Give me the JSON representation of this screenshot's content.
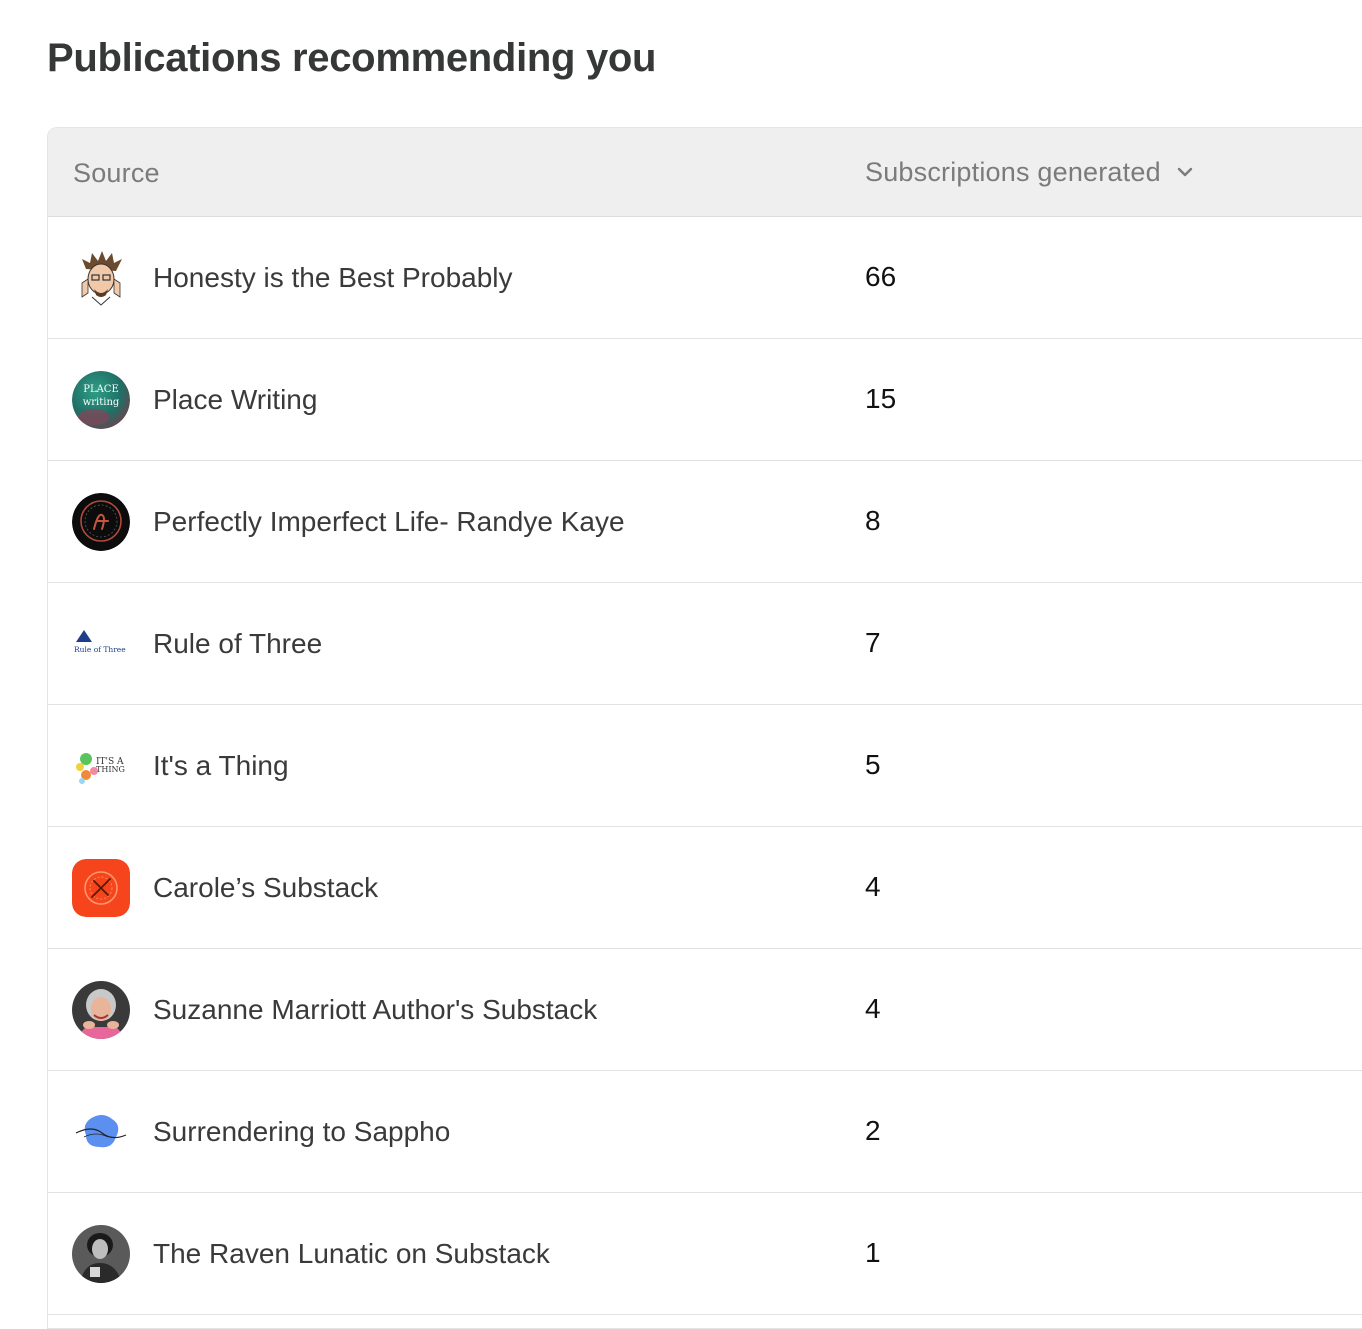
{
  "page": {
    "title": "Publications recommending you"
  },
  "table": {
    "headers": {
      "source": "Source",
      "subscriptions": "Subscriptions generated",
      "sort_icon": "chevron-down-icon"
    },
    "rows": [
      {
        "name": "Honesty is the Best Probably",
        "count": "66",
        "avatar": "cartoon-face-avatar"
      },
      {
        "name": "Place Writing",
        "count": "15",
        "avatar": "place-writing-logo",
        "logo_text": [
          "PLACE",
          "writing"
        ]
      },
      {
        "name": "Perfectly Imperfect Life- Randye Kaye",
        "count": "8",
        "avatar": "monogram-logo"
      },
      {
        "name": "Rule of Three",
        "count": "7",
        "avatar": "rule-of-three-logo",
        "logo_text": "Rule of Three"
      },
      {
        "name": "It's a Thing",
        "count": "5",
        "avatar": "its-a-thing-logo",
        "logo_text": [
          "IT'S A",
          "THING"
        ]
      },
      {
        "name": "Carole’s Substack",
        "count": "4",
        "avatar": "orange-badge-logo"
      },
      {
        "name": "Suzanne Marriott Author's Substack",
        "count": "4",
        "avatar": "portrait-photo"
      },
      {
        "name": "Surrendering to Sappho",
        "count": "2",
        "avatar": "blue-splash-logo"
      },
      {
        "name": "The Raven Lunatic on Substack",
        "count": "1",
        "avatar": "bw-portrait-photo"
      }
    ]
  },
  "colors": {
    "title": "#363737",
    "header_bg": "#efefef",
    "header_text": "#7b7b7b",
    "row_border": "#e2e2e2",
    "count_text": "#111111"
  }
}
